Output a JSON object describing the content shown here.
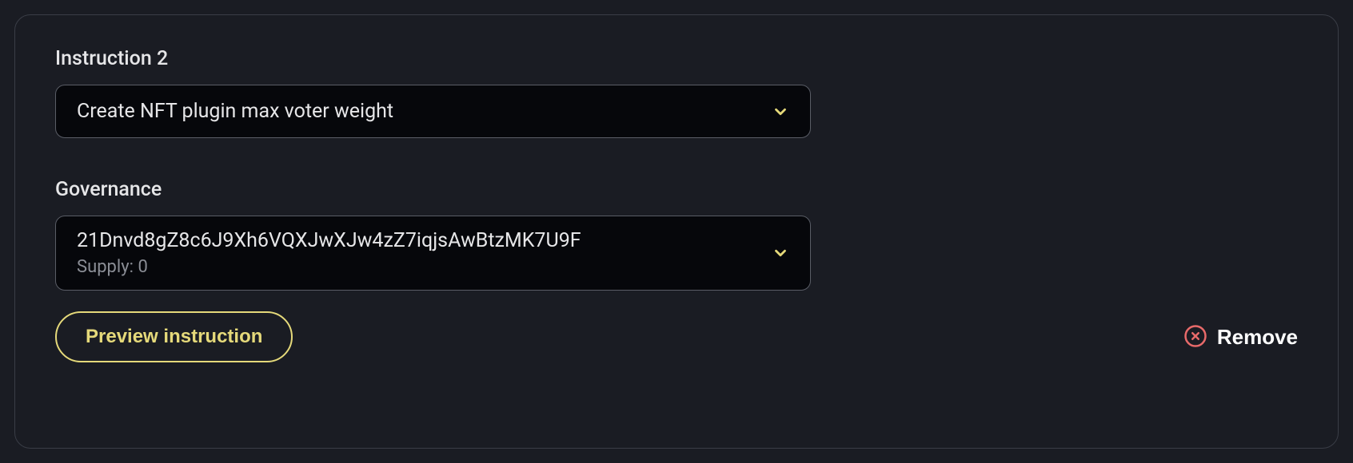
{
  "instruction": {
    "title": "Instruction 2",
    "dropdown_value": "Create NFT plugin max voter weight"
  },
  "governance": {
    "title": "Governance",
    "address": "21Dnvd8gZ8c6J9Xh6VQXJwXJw4zZ7iqjsAwBtzMK7U9F",
    "supply_label": "Supply: 0"
  },
  "footer": {
    "preview_label": "Preview instruction",
    "remove_label": "Remove"
  },
  "colors": {
    "accent": "#e5d97a",
    "danger": "#e86a6a"
  }
}
